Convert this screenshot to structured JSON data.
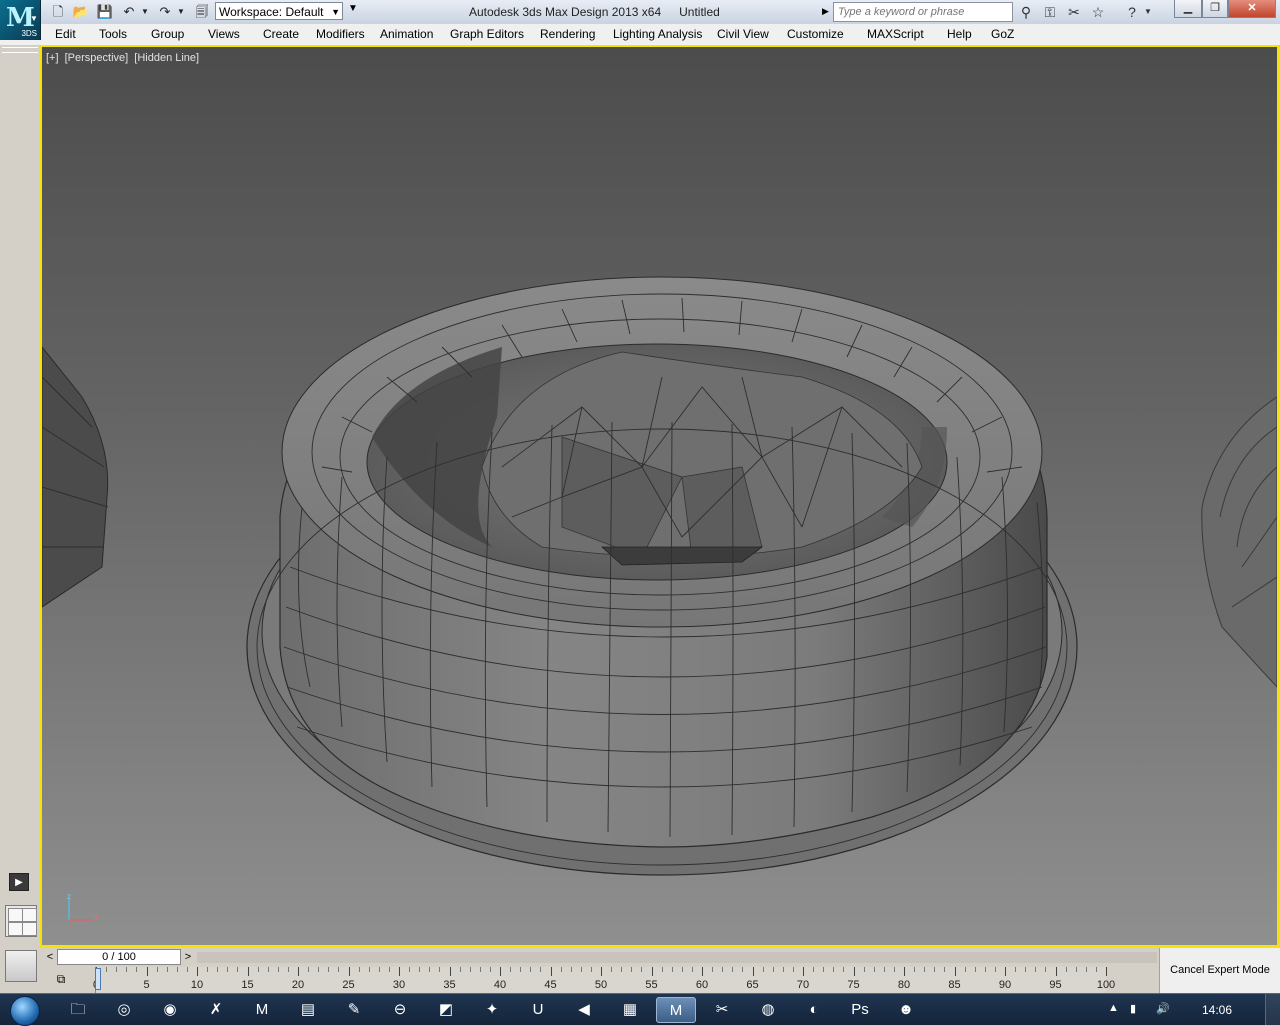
{
  "titlebar": {
    "app_logo_text": "3DS",
    "workspace": "Workspace: Default",
    "title": "Autodesk 3ds Max Design 2013 x64",
    "document": "Untitled",
    "search_placeholder": "Type a keyword or phrase",
    "quick_access_icons": [
      "new-file-icon",
      "open-file-icon",
      "save-icon",
      "undo-icon",
      "undo-dropdown-icon",
      "redo-icon",
      "redo-dropdown-icon",
      "project-folder-icon"
    ],
    "help_icons": [
      "binoculars-icon",
      "key-icon",
      "communication-center-icon",
      "favorites-star-icon",
      "help-icon"
    ]
  },
  "menu": {
    "items": [
      "Edit",
      "Tools",
      "Group",
      "Views",
      "Create",
      "Modifiers",
      "Animation",
      "Graph Editors",
      "Rendering",
      "Lighting Analysis",
      "Civil View",
      "Customize",
      "MAXScript",
      "Help",
      "GoZ"
    ]
  },
  "viewport": {
    "plus": "[+]",
    "view": "[Perspective]",
    "shading": "[Hidden Line]",
    "axis_z": "z",
    "axis_x": "x",
    "border_color": "#f4e400"
  },
  "timeline": {
    "frame_display": "0 / 100",
    "prev": "<",
    "next": ">",
    "ticks": [
      "0",
      "5",
      "10",
      "15",
      "20",
      "25",
      "30",
      "35",
      "40",
      "45",
      "50",
      "55",
      "60",
      "65",
      "70",
      "75",
      "80",
      "85",
      "90",
      "95",
      "100"
    ],
    "current_frame": 0,
    "total_frames": 100
  },
  "expert_mode": {
    "label": "Cancel Expert Mode"
  },
  "taskbar": {
    "apps": [
      "windows-explorer-icon",
      "browser-icon",
      "chrome-icon",
      "xmind-icon",
      "m-app-icon",
      "app-icon",
      "stylus-icon",
      "dashboard-icon",
      "sketchbook-icon",
      "adobe-icon",
      "u-icon",
      "media-icon",
      "zip-icon",
      "3ds-max-icon",
      "toolbox-icon",
      "app-circle-icon",
      "firefox-icon",
      "photoshop-icon",
      "user-icon"
    ],
    "clock": "14:06"
  }
}
